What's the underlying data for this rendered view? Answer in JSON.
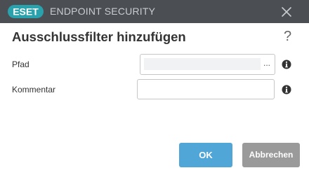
{
  "titlebar": {
    "logo_text": "ESET",
    "app_name": "ENDPOINT SECURITY"
  },
  "dialog": {
    "title": "Ausschlussfilter hinzufügen",
    "help": "?"
  },
  "form": {
    "path_label": "Pfad",
    "path_value": "",
    "path_browse": "...",
    "comment_label": "Kommentar",
    "comment_value": "",
    "comment_placeholder": ""
  },
  "buttons": {
    "ok": "OK",
    "cancel": "Abbrechen"
  },
  "colors": {
    "titlebar_bg": "#4b4f53",
    "brand_teal": "#29a2ad",
    "ok_button": "#50a6d7",
    "cancel_button": "#9a9a9a"
  }
}
